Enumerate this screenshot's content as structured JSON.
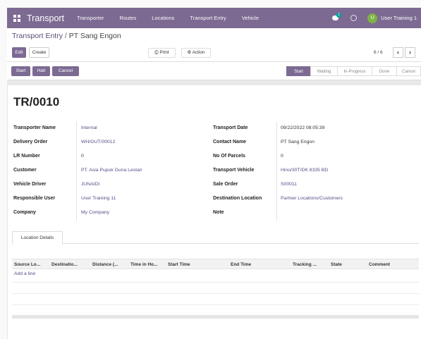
{
  "topbar": {
    "app_title": "Transport",
    "nav": [
      "Transporter",
      "Routes",
      "Locations",
      "Transport Entry",
      "Vehicle"
    ],
    "chat_badge": "1",
    "avatar_letter": "U",
    "username": "User Training 1"
  },
  "control": {
    "breadcrumb_parent": "Transport Entry",
    "breadcrumb_sep": "/",
    "breadcrumb_current": "PT Sang Engon",
    "edit_label": "Edit",
    "create_label": "Create",
    "print_label": "Print",
    "action_label": "Action",
    "pager": "6 / 6",
    "prev": "‹",
    "next": "›"
  },
  "statusbar": {
    "start_label": "Start",
    "halt_label": "Halt",
    "cancel_label": "Cancel",
    "stages": [
      "Start",
      "Waiting",
      "In-Progress",
      "Done",
      "Cancel"
    ],
    "active_stage": "Start"
  },
  "record": {
    "ref": "TR/0010",
    "left_fields": [
      {
        "label": "Transporter Name",
        "value": "Internal"
      },
      {
        "label": "Delivery Order",
        "value": "WH/OUT/00012"
      },
      {
        "label": "LR Number",
        "value": "0"
      },
      {
        "label": "Customer",
        "value": "PT. Asia Pupuk Guna Lestari"
      },
      {
        "label": "Vehicle Driver",
        "value": "JUNAIDI"
      },
      {
        "label": "Responsible User",
        "value": "User Training 11"
      },
      {
        "label": "Company",
        "value": "My Company"
      }
    ],
    "right_fields": [
      {
        "label": "Transport Date",
        "value": "09/22/2022 08:05:39"
      },
      {
        "label": "Contact Name",
        "value": "PT Sang Engon"
      },
      {
        "label": "No Of Parcels",
        "value": "0"
      },
      {
        "label": "Transport Vehicle",
        "value": "Hino/30T/DK 8335 BD"
      },
      {
        "label": "Sale Order",
        "value": "S00011"
      },
      {
        "label": "Destination Location",
        "value": "Partner Locations/Customers"
      },
      {
        "label": "Note",
        "value": ""
      }
    ]
  },
  "tabs": {
    "location_details": "Location Details"
  },
  "table": {
    "columns": [
      "Source Lo...",
      "Destinatio...",
      "Distance (...",
      "Time in Ho...",
      "Start Time",
      "End Time",
      "Tracking ...",
      "State",
      "Comment"
    ],
    "add_line": "Add a line"
  }
}
